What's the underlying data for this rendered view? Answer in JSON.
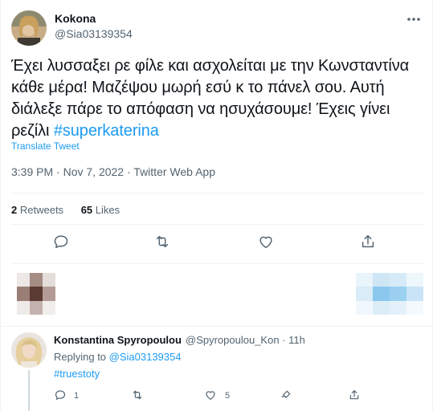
{
  "tweet": {
    "author_name": "Kokona",
    "author_handle": "@Sia03139354",
    "text": "Έχει λυσσαξει ρε φίλε και ασχολείται με την Κωνσταντίνα κάθε μέρα! Μαζέψου μωρή εσύ κ το πάνελ σου. Αυτή διάλεξε πάρε το απόφαση να ησυχάσουμε! Έχεις γίνει ρεζίλι ",
    "hashtag": "#superkaterina",
    "translate_label": "Translate Tweet",
    "time": "3:39 PM",
    "date": "Nov 7, 2022",
    "source": "Twitter Web App",
    "separator": " · ",
    "retweets_count": "2",
    "retweets_label": "Retweets",
    "likes_count": "65",
    "likes_label": "Likes"
  },
  "reply": {
    "author_name": "Konstantina Spyropoulou",
    "author_handle": "@Spyropoulou_Kon",
    "age": "11h",
    "replying_prefix": "Replying to ",
    "replying_to": "@Sia03139354",
    "text": "#truestoty",
    "reply_count": "1",
    "like_count": "5"
  },
  "icons": {
    "more": "more-horizontal-icon",
    "reply": "reply-bubble-icon",
    "retweet": "retweet-icon",
    "like": "heart-icon",
    "share": "share-upload-icon"
  },
  "colors": {
    "accent": "#1d9bf0",
    "text_primary": "#0f1419",
    "text_secondary": "#536471",
    "divider": "#eff3f4"
  }
}
